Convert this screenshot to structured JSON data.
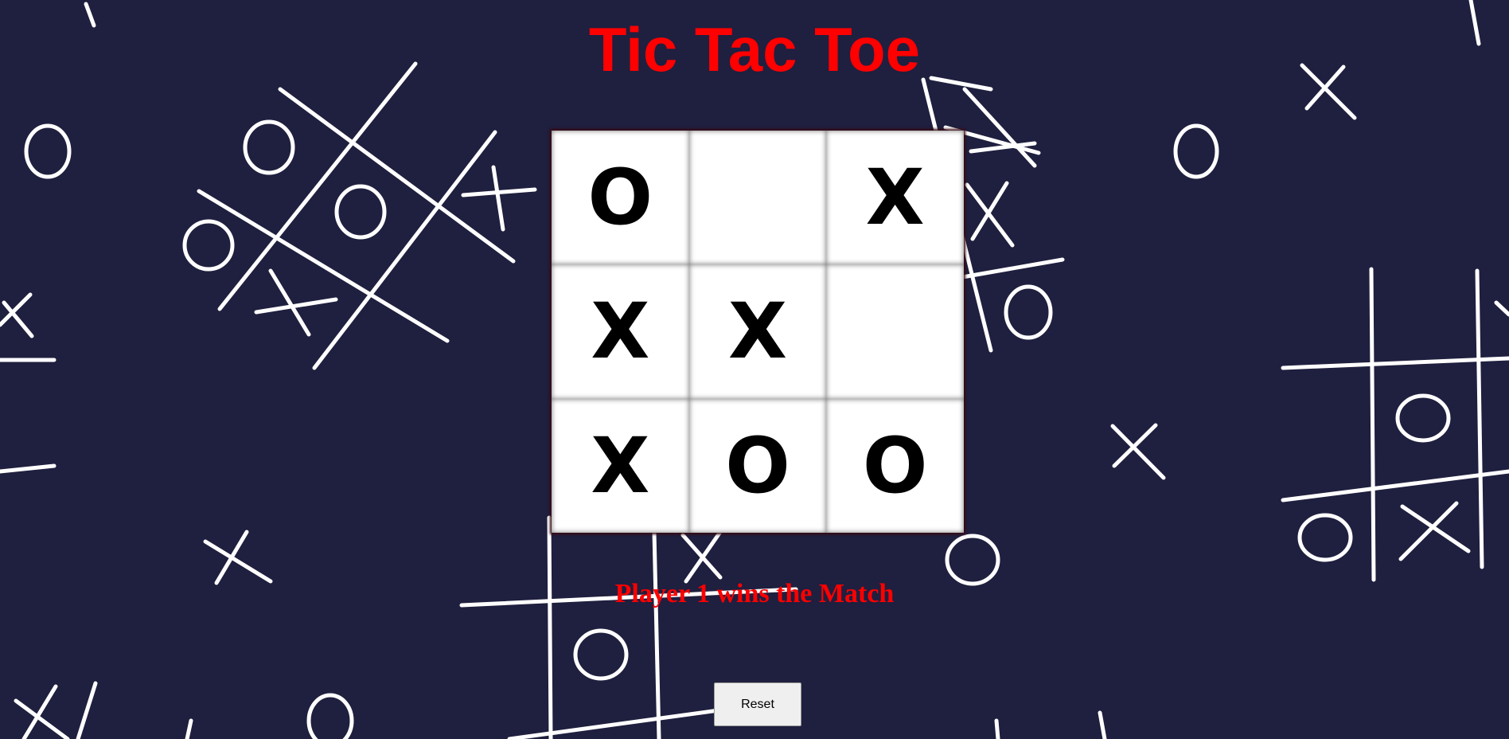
{
  "title": "Tic Tac Toe",
  "board": [
    [
      "O",
      "",
      "X"
    ],
    [
      "X",
      "X",
      ""
    ],
    [
      "X",
      "O",
      "O"
    ]
  ],
  "status": "Player 1 wins the Match",
  "reset_label": "Reset",
  "colors": {
    "background": "#1f1f3f",
    "accent": "#ff0000",
    "cell": "#ffffff",
    "mark": "#000000"
  }
}
